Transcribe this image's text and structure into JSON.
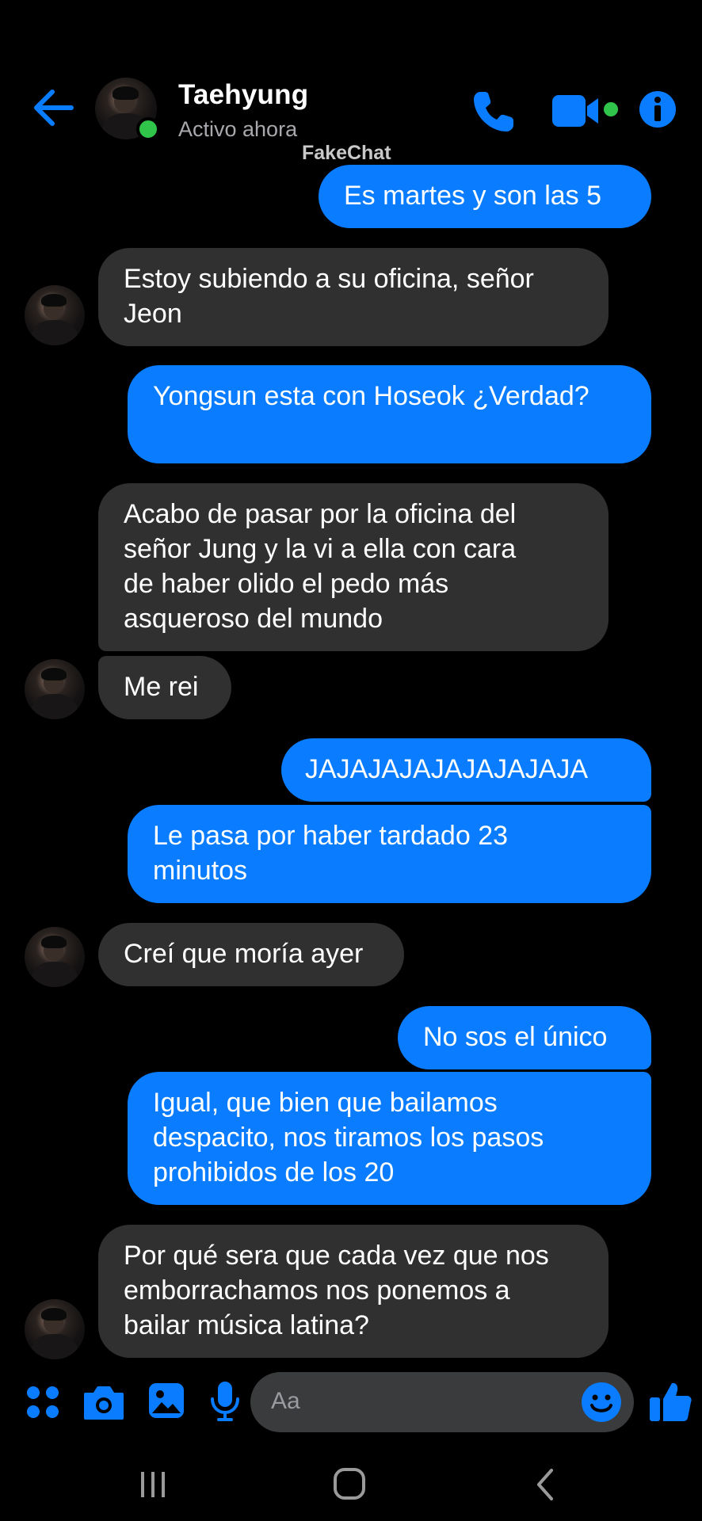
{
  "colors": {
    "accent": "#0a7cff",
    "background": "#000000",
    "incoming_bubble": "#303030",
    "online": "#31c44a"
  },
  "header": {
    "back_icon": "arrow-left-icon",
    "contact_name": "Taehyung",
    "status": "Activo ahora",
    "call_icon": "phone-icon",
    "video_icon": "video-camera-icon",
    "info_icon": "info-icon"
  },
  "watermark": "FakeChat",
  "messages": [
    {
      "dir": "out",
      "text": "Es martes y son las 5"
    },
    {
      "dir": "in",
      "text": "Estoy subiendo a su oficina, señor Jeon"
    },
    {
      "dir": "out",
      "text": "Yongsun esta con Hoseok ¿Verdad?"
    },
    {
      "dir": "in",
      "text": "Acabo de pasar por la oficina del señor Jung y la vi a ella con cara de haber olido el pedo más asqueroso del mundo"
    },
    {
      "dir": "in",
      "text": "Me rei"
    },
    {
      "dir": "out",
      "text": "JAJAJAJAJAJAJAJAJA"
    },
    {
      "dir": "out",
      "text": "Le pasa por haber tardado 23 minutos"
    },
    {
      "dir": "in",
      "text": "Creí que moría ayer"
    },
    {
      "dir": "out",
      "text": "No sos el único"
    },
    {
      "dir": "out",
      "text": "Igual, que bien que bailamos despacito, nos tiramos los pasos prohibidos de los 20"
    },
    {
      "dir": "in",
      "text": "Por qué sera que cada vez que nos emborrachamos nos ponemos a bailar música latina?"
    }
  ],
  "composer": {
    "placeholder": "Aa",
    "icons": [
      "apps-icon",
      "camera-icon",
      "gallery-icon",
      "microphone-icon",
      "emoji-icon",
      "thumbs-up-icon"
    ]
  },
  "navbar": {
    "icons": [
      "recent-apps-icon",
      "home-icon",
      "back-icon"
    ]
  }
}
